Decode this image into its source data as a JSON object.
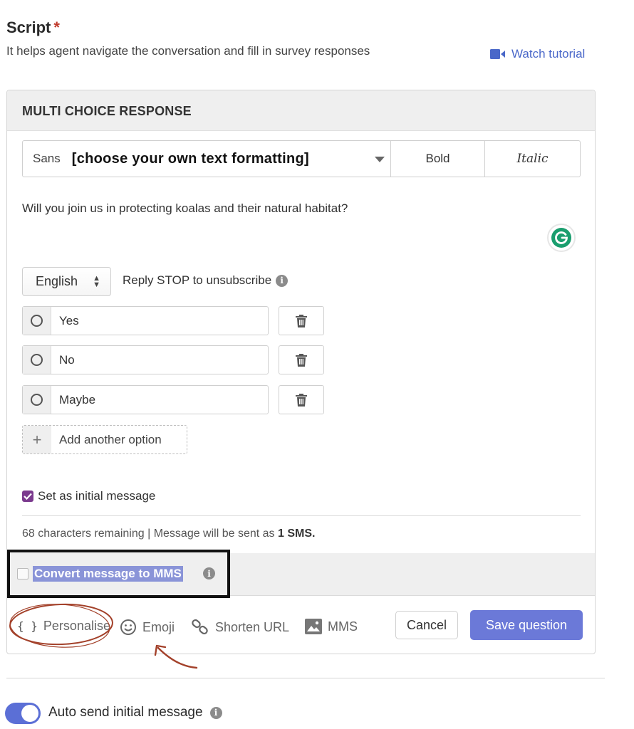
{
  "header": {
    "title": "Script",
    "required_mark": "*",
    "description": "It helps agent navigate the conversation and fill in survey responses",
    "watch_tutorial": "Watch tutorial"
  },
  "card": {
    "title": "MULTI CHOICE RESPONSE",
    "format_bar": {
      "font_name": "Sans",
      "font_hint": "[choose your own text formatting]",
      "bold": "Bold",
      "italic": "Italic"
    },
    "question": "Will you join us in protecting koalas and their natural habitat?",
    "language": "English",
    "unsubscribe_text": "Reply STOP to unsubscribe",
    "options": [
      {
        "label": "Yes"
      },
      {
        "label": "No"
      },
      {
        "label": "Maybe"
      }
    ],
    "add_option": "Add another option",
    "initial_message_label": "Set as initial message",
    "initial_message_checked": true,
    "char_info_prefix": "68 characters remaining | Message will be sent as ",
    "char_info_bold": "1 SMS.",
    "convert_mms": "Convert message to MMS",
    "tools": {
      "personalise_icon": "{ }",
      "personalise": "Personalise",
      "emoji": "Emoji",
      "shorten_url": "Shorten URL",
      "mms": "MMS"
    },
    "cancel": "Cancel",
    "save": "Save question"
  },
  "auto_send": {
    "label": "Auto send initial message",
    "enabled": true
  },
  "colors": {
    "accent": "#6b79d8",
    "link": "#4a68c9",
    "checkbox": "#7b3a8e",
    "annotation": "#a3412a"
  }
}
